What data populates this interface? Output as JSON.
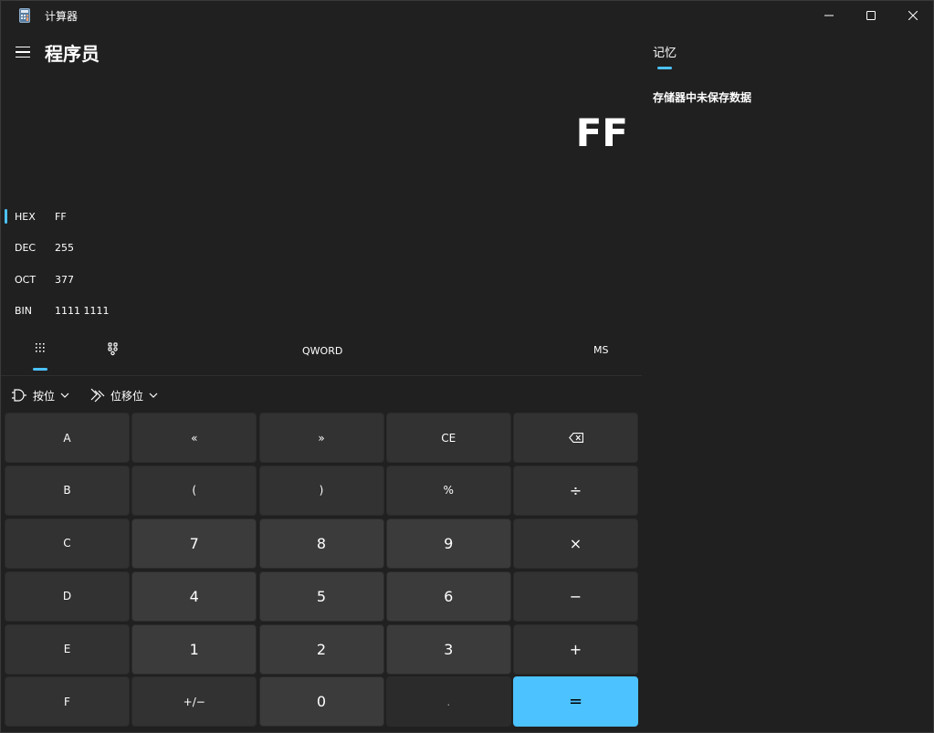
{
  "window": {
    "title": "计算器",
    "controls": {
      "minimize": "minimize",
      "maximize": "maximize",
      "close": "close"
    }
  },
  "header": {
    "mode_title": "程序员"
  },
  "display": {
    "value": "FF"
  },
  "radix": [
    {
      "label": "HEX",
      "value": "FF",
      "selected": true
    },
    {
      "label": "DEC",
      "value": "255",
      "selected": false
    },
    {
      "label": "OCT",
      "value": "377",
      "selected": false
    },
    {
      "label": "BIN",
      "value": "1111 1111",
      "selected": false
    }
  ],
  "toolbar": {
    "word_size": "QWORD",
    "ms": "MS"
  },
  "dropdowns": {
    "bitwise": "按位",
    "bit_shift": "位移位"
  },
  "keypad": {
    "rows": [
      [
        "A",
        "«",
        "»",
        "CE",
        "⌫"
      ],
      [
        "B",
        "(",
        ")",
        "%",
        "÷"
      ],
      [
        "C",
        "7",
        "8",
        "9",
        "×"
      ],
      [
        "D",
        "4",
        "5",
        "6",
        "−"
      ],
      [
        "E",
        "1",
        "2",
        "3",
        "+"
      ],
      [
        "F",
        "+/−",
        "0",
        ".",
        "="
      ]
    ]
  },
  "memory": {
    "tab": "记忆",
    "empty_message": "存储器中未保存数据"
  },
  "colors": {
    "accent": "#4cc2ff",
    "background": "#202020",
    "key": "#3b3b3b"
  }
}
